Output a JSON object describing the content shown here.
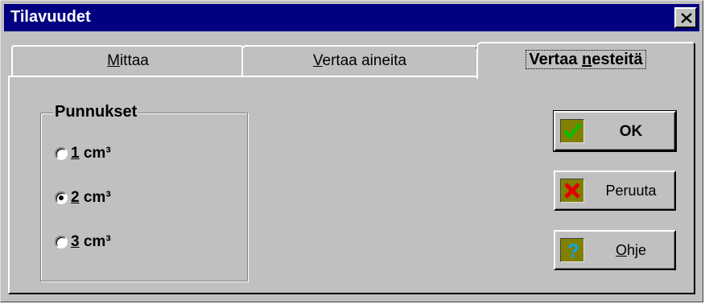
{
  "window": {
    "title": "Tilavuudet"
  },
  "tabs": [
    {
      "label_pre": "",
      "label_u": "M",
      "label_post": "ittaa"
    },
    {
      "label_pre": "",
      "label_u": "V",
      "label_post": "ertaa aineita"
    },
    {
      "label_pre": "Vertaa ",
      "label_u": "n",
      "label_post": "esteitä",
      "selected": true
    }
  ],
  "group": {
    "title": "Punnukset",
    "options": [
      {
        "label_u": "1",
        "label_post": " cm³",
        "selected": false
      },
      {
        "label_u": "2",
        "label_post": " cm³",
        "selected": true
      },
      {
        "label_u": "3",
        "label_post": " cm³",
        "selected": false
      }
    ]
  },
  "buttons": {
    "ok": {
      "label": "OK",
      "icon": "check-icon"
    },
    "cancel": {
      "label": "Peruuta",
      "icon": "cross-icon"
    },
    "help": {
      "label_u": "O",
      "label_post": "hje",
      "icon": "question-icon"
    }
  }
}
